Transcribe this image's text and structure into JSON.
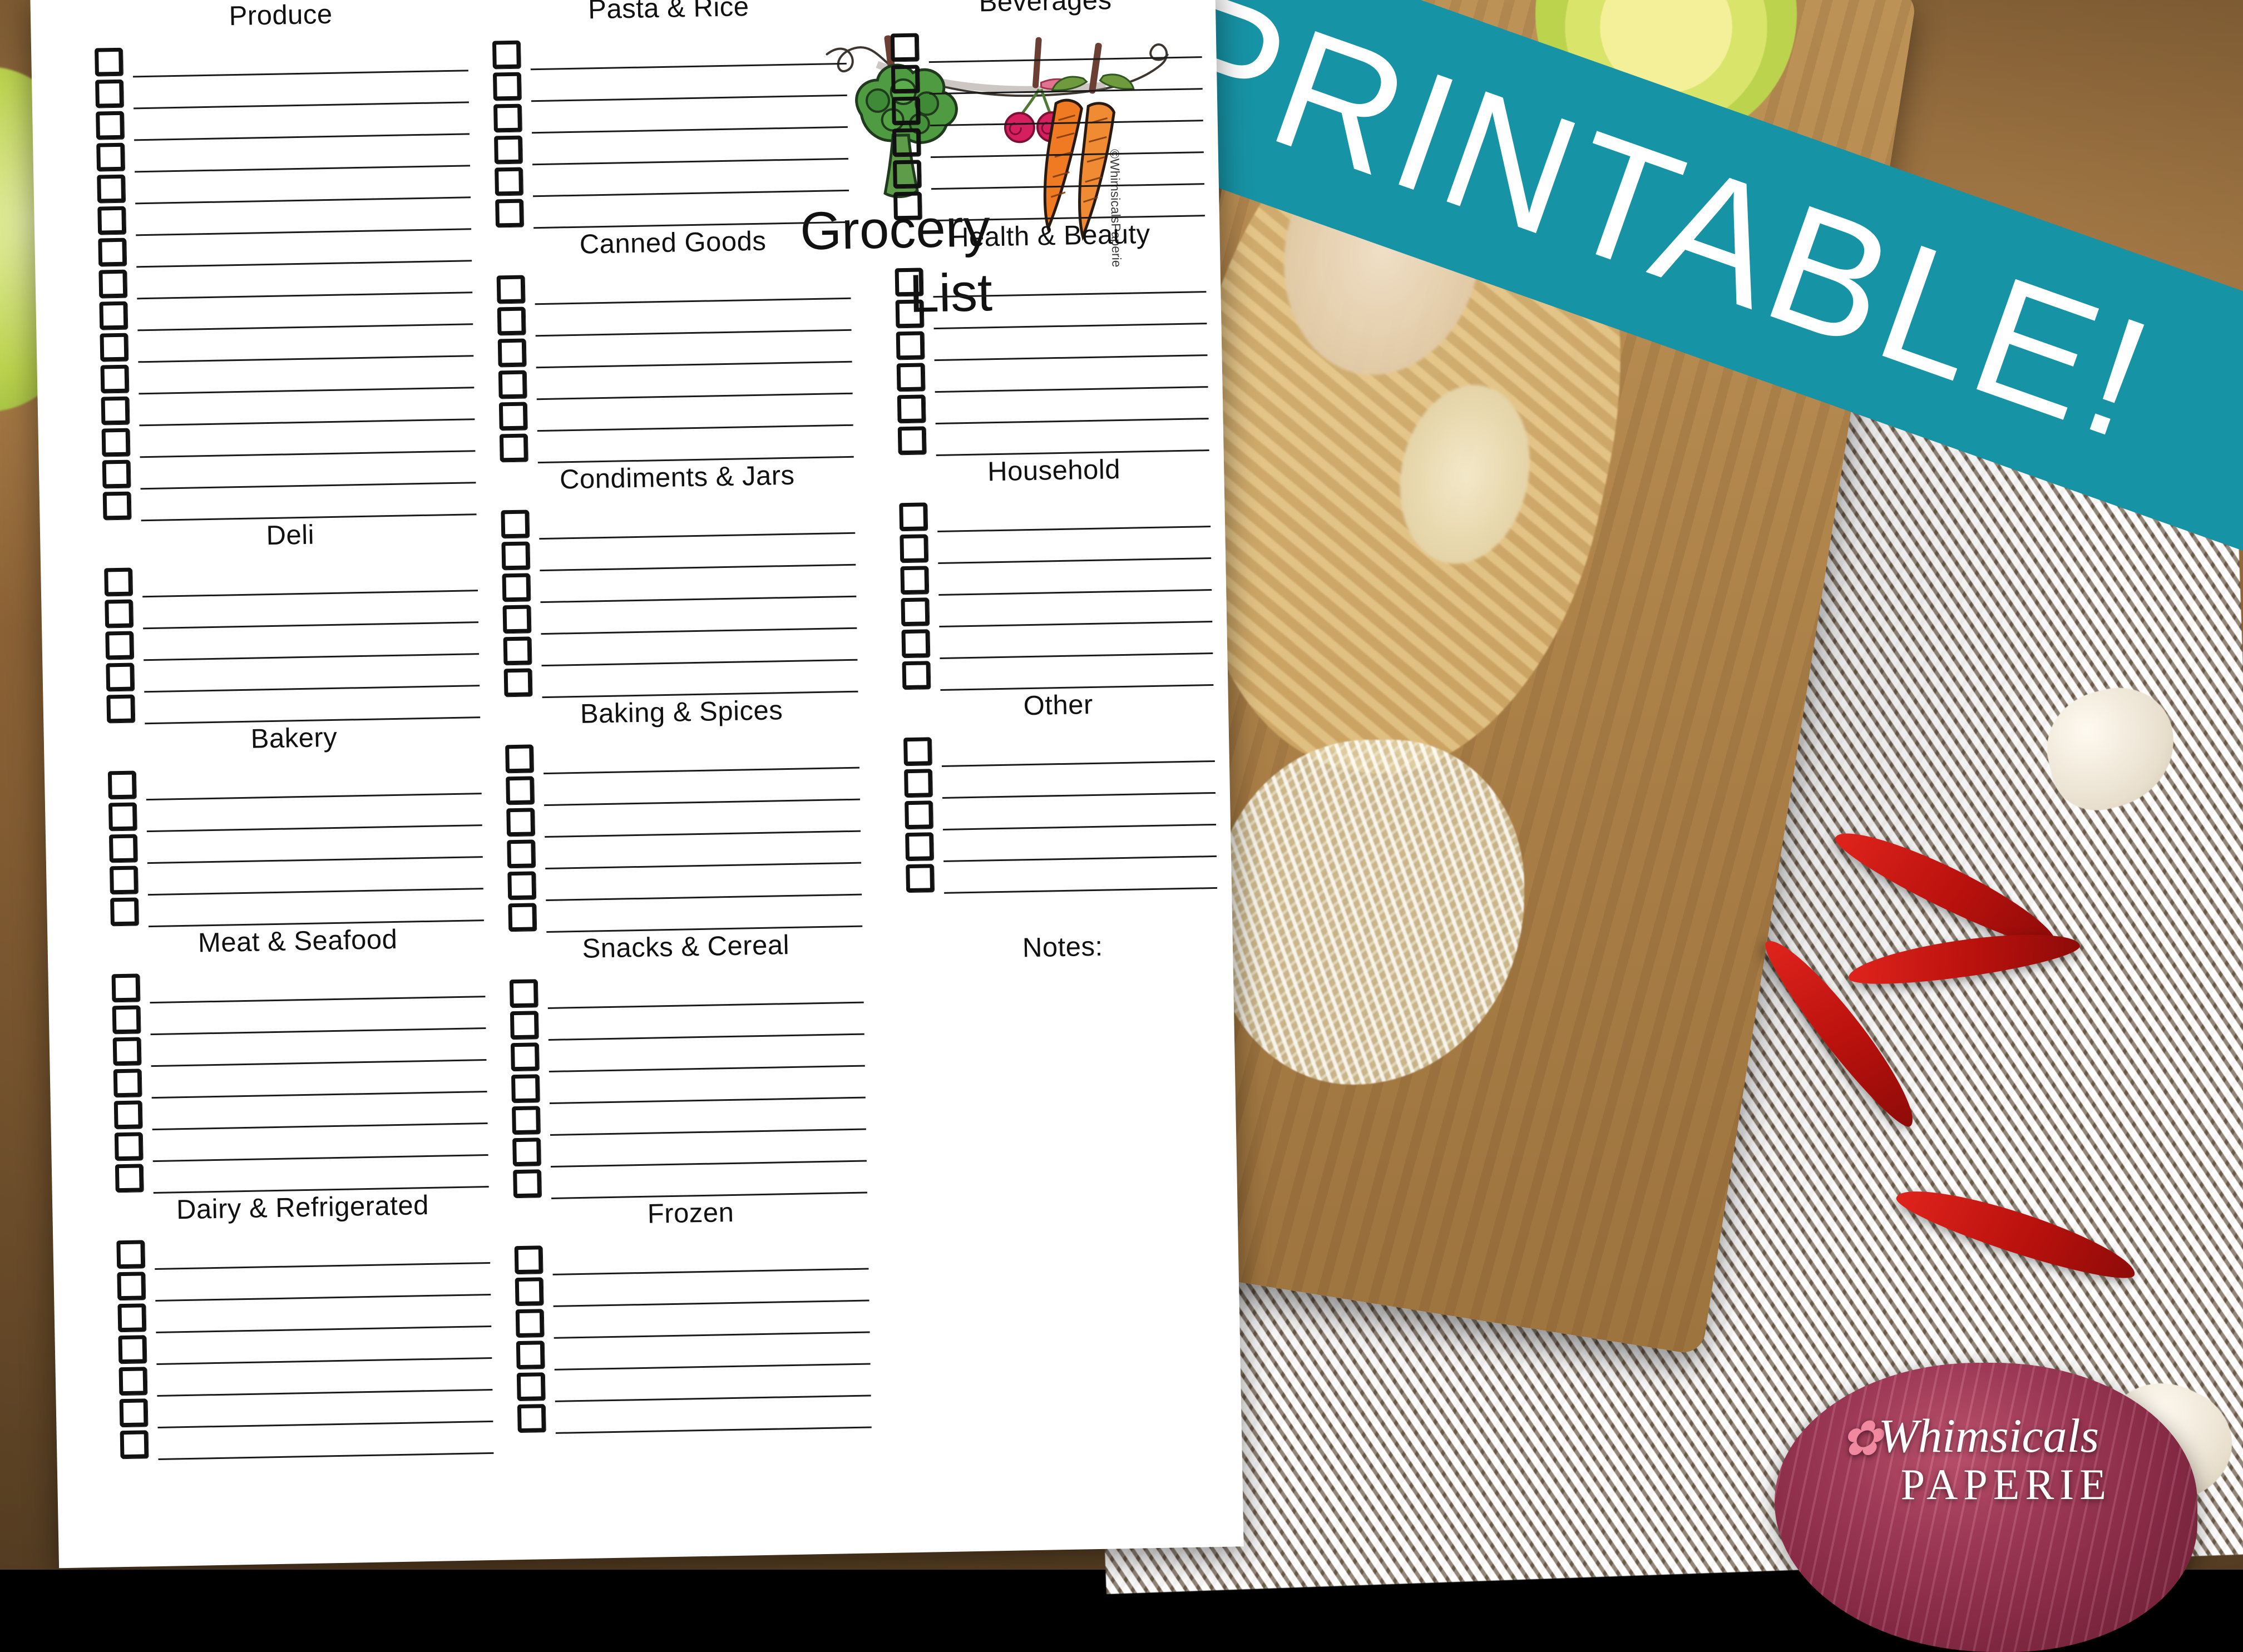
{
  "banner": {
    "label": "PRINTABLE!",
    "color": "#1793a6"
  },
  "logo": {
    "title_line1": "Grocery",
    "title_line2": "List",
    "copyright": "©WhimsicalsPaperie",
    "icons": [
      "broccoli-illustration",
      "cherries-illustration",
      "carrots-illustration",
      "branch-illustration"
    ]
  },
  "watermark": {
    "brand_script": "Whimsicals",
    "brand_serif": "PAPERIE"
  },
  "sheet": {
    "columns": [
      {
        "name": "left-column",
        "sections": [
          {
            "title": "Produce",
            "rows": 15
          },
          {
            "title": "Deli",
            "rows": 5
          },
          {
            "title": "Bakery",
            "rows": 5
          },
          {
            "title": "Meat & Seafood",
            "rows": 7
          },
          {
            "title": "Dairy & Refrigerated",
            "rows": 7
          }
        ]
      },
      {
        "name": "middle-column",
        "sections": [
          {
            "title": "Pasta & Rice",
            "rows": 6
          },
          {
            "title": "Canned Goods",
            "rows": 6
          },
          {
            "title": "Condiments & Jars",
            "rows": 6
          },
          {
            "title": "Baking & Spices",
            "rows": 6
          },
          {
            "title": "Snacks & Cereal",
            "rows": 7
          },
          {
            "title": "Frozen",
            "rows": 6
          }
        ]
      },
      {
        "name": "right-column",
        "sections": [
          {
            "title": "Beverages",
            "rows": 6
          },
          {
            "title": "Health & Beauty",
            "rows": 6
          },
          {
            "title": "Household",
            "rows": 6
          },
          {
            "title": "Other",
            "rows": 5
          },
          {
            "title": "Notes:",
            "rows": 0
          }
        ]
      }
    ]
  }
}
